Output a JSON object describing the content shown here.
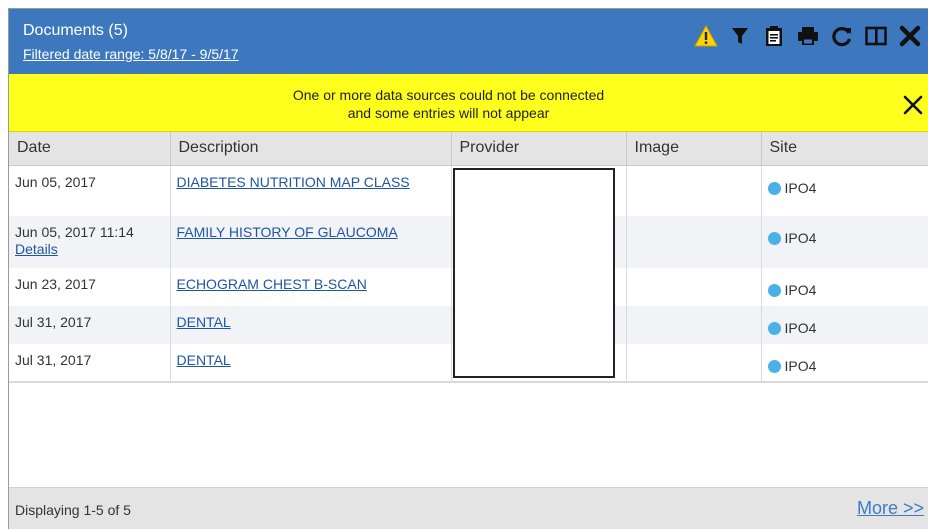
{
  "header": {
    "title": "Documents (5)",
    "filter_label": "Filtered date range: 5/8/17 - 9/5/17",
    "toolbar": [
      {
        "icon": "warning-icon"
      },
      {
        "icon": "filter-icon"
      },
      {
        "icon": "clipboard-icon"
      },
      {
        "icon": "print-icon"
      },
      {
        "icon": "refresh-icon"
      },
      {
        "icon": "split-view-icon"
      },
      {
        "icon": "close-icon"
      }
    ]
  },
  "alert": {
    "line1": "One or more data sources could not be connected",
    "line2": "and some entries will not appear"
  },
  "table": {
    "columns": [
      "Date",
      "Description",
      "Provider",
      "Image",
      "Site"
    ],
    "rows": [
      {
        "date": "Jun 05, 2017",
        "details": "",
        "description": "DIABETES NUTRITION MAP CLASS",
        "provider": "",
        "image": "",
        "site": "IPO4"
      },
      {
        "date": "Jun 05, 2017 11:14",
        "details": "Details",
        "description": "FAMILY HISTORY OF GLAUCOMA",
        "provider": "",
        "image": "",
        "site": "IPO4"
      },
      {
        "date": "Jun 23, 2017",
        "details": "",
        "description": "ECHOGRAM CHEST B-SCAN",
        "provider": "",
        "image": "",
        "site": "IPO4"
      },
      {
        "date": "Jul 31, 2017",
        "details": "",
        "description": "DENTAL",
        "provider": "",
        "image": "",
        "site": "IPO4"
      },
      {
        "date": "Jul 31, 2017",
        "details": "",
        "description": "DENTAL",
        "provider": "",
        "image": "",
        "site": "IPO4"
      }
    ]
  },
  "footer": {
    "count": "Displaying 1-5 of 5",
    "more": "More >>"
  },
  "colors": {
    "header_bg": "#3d78be",
    "alert_bg": "#ffff1e",
    "link": "#1f56a4",
    "site_dot": "#4ab1e6"
  }
}
